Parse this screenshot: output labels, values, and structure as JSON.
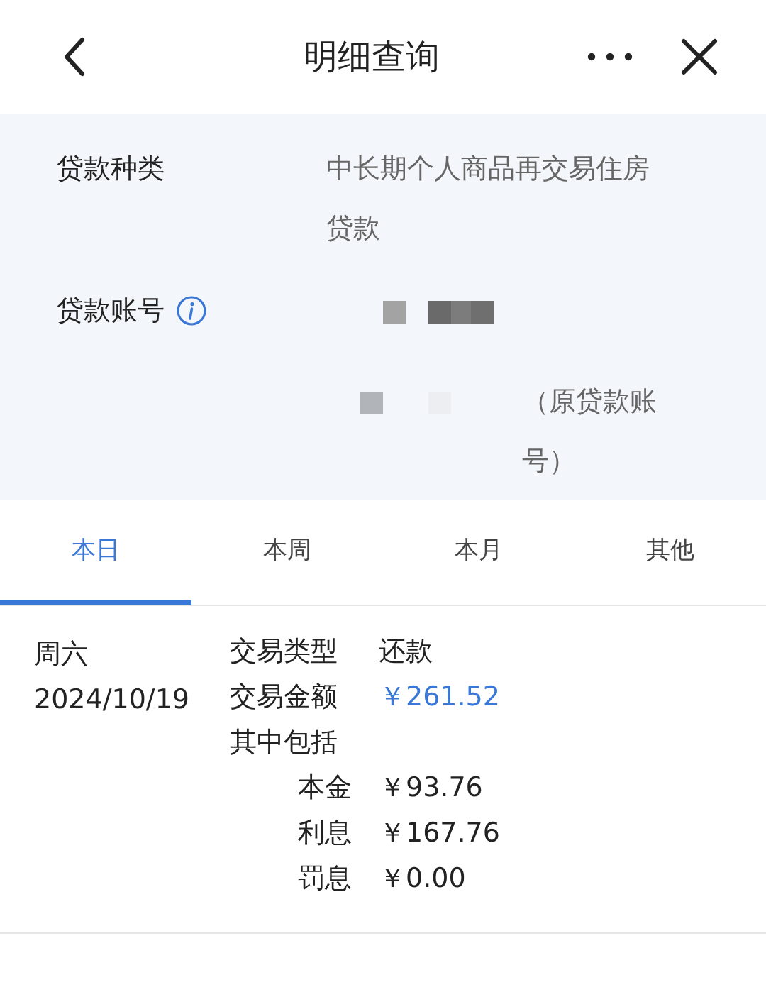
{
  "header": {
    "title": "明细查询"
  },
  "loan": {
    "type_label": "贷款种类",
    "type_value": "中长期个人商品再交易住房贷款",
    "account_label": "贷款账号",
    "account_note": "（原贷款账号）"
  },
  "tabs": [
    {
      "label": "本日",
      "selected": true
    },
    {
      "label": "本周",
      "selected": false
    },
    {
      "label": "本月",
      "selected": false
    },
    {
      "label": "其他",
      "selected": false
    }
  ],
  "record": {
    "weekday": "周六",
    "date": "2024/10/19",
    "fields": [
      {
        "label": "交易类型",
        "value": "还款",
        "emphasis": false
      },
      {
        "label": "交易金额",
        "value": "￥261.52",
        "emphasis": true
      }
    ],
    "breakdown_title": "其中包括",
    "breakdown": [
      {
        "label": "本金",
        "value": "￥93.76"
      },
      {
        "label": "利息",
        "value": "￥167.76"
      },
      {
        "label": "罚息",
        "value": "￥0.00"
      }
    ]
  }
}
